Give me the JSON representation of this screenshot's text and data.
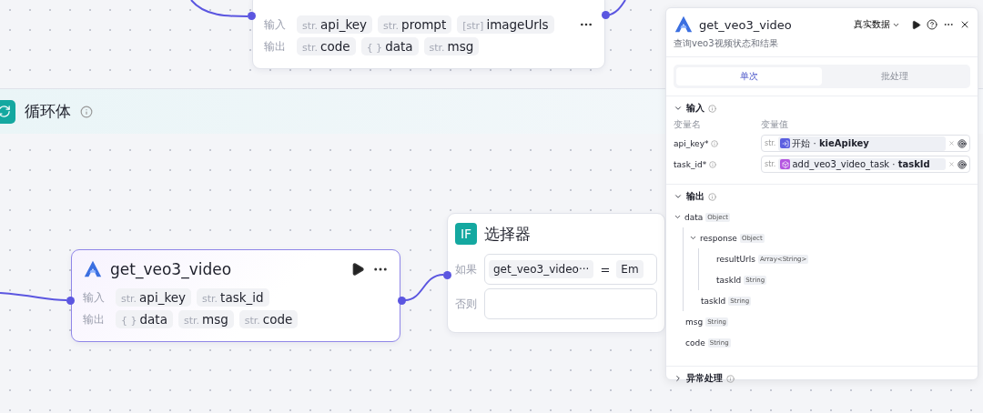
{
  "top_node": {
    "input_label": "输入",
    "output_label": "输出",
    "inputs": [
      {
        "type": "str.",
        "name": "api_key"
      },
      {
        "type": "str.",
        "name": "prompt"
      },
      {
        "type": "[str]",
        "name": "imageUrls"
      }
    ],
    "outputs": [
      {
        "type": "str.",
        "name": "code"
      },
      {
        "type": "{ }",
        "name": "data"
      },
      {
        "type": "str.",
        "name": "msg"
      }
    ]
  },
  "loop": {
    "title": "循环体"
  },
  "node": {
    "title": "get_veo3_video",
    "input_label": "输入",
    "output_label": "输出",
    "inputs": [
      {
        "type": "str.",
        "name": "api_key"
      },
      {
        "type": "str.",
        "name": "task_id"
      }
    ],
    "outputs": [
      {
        "type": "{ }",
        "name": "data"
      },
      {
        "type": "str.",
        "name": "msg"
      },
      {
        "type": "str.",
        "name": "code"
      }
    ]
  },
  "selector": {
    "badge": "IF",
    "title": "选择器",
    "if_label": "如果",
    "condition": "get_veo3_video···",
    "operator": "=",
    "value": "Em",
    "else_label": "否则"
  },
  "panel": {
    "title": "get_veo3_video",
    "mode": "真实数据",
    "description": "查询veo3视频状态和结果",
    "tabs": [
      {
        "label": "单次",
        "selected": true
      },
      {
        "label": "批处理",
        "selected": false
      }
    ],
    "input_section": {
      "title": "输入",
      "expanded": true,
      "name_header": "变量名",
      "value_header": "变量值",
      "rows": [
        {
          "name": "api_key*",
          "type": "str.",
          "kind": "start",
          "source": "开始 · **kieApikey**"
        },
        {
          "name": "task_id*",
          "type": "str.",
          "kind": "node",
          "source": "add_veo3_video_task · **taskId**"
        }
      ]
    },
    "output_section": {
      "title": "输出",
      "expanded": true,
      "tree": [
        {
          "name": "data",
          "type": "Object",
          "expanded": true,
          "children": [
            {
              "name": "response",
              "type": "Object",
              "expanded": true,
              "children": [
                {
                  "name": "resultUrls",
                  "type": "Array<String>"
                },
                {
                  "name": "taskId",
                  "type": "String"
                }
              ]
            },
            {
              "name": "taskId",
              "type": "String"
            }
          ]
        },
        {
          "name": "msg",
          "type": "String"
        },
        {
          "name": "code",
          "type": "String"
        }
      ]
    },
    "error_section": {
      "title": "异常处理",
      "expanded": false
    }
  }
}
